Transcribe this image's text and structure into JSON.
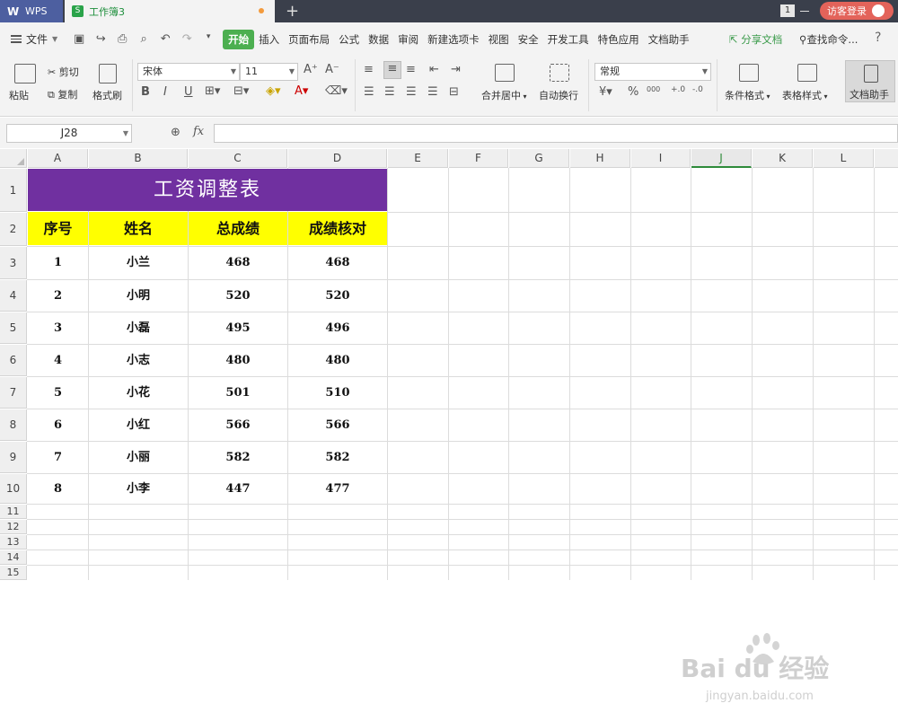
{
  "titlebar": {
    "app_name": "WPS",
    "doc_tab": "工作簿3",
    "doc_icon": "S",
    "window_badge": "1",
    "login": "访客登录",
    "new_tab": "+"
  },
  "menubar": {
    "file": "文件",
    "items": [
      "开始",
      "插入",
      "页面布局",
      "公式",
      "数据",
      "审阅",
      "新建选项卡",
      "视图",
      "安全",
      "开发工具",
      "特色应用",
      "文档助手"
    ],
    "active": "开始",
    "share": "分享文档",
    "find": "查找命令...",
    "help": "?"
  },
  "ribbon": {
    "paste": "粘贴",
    "cut": "剪切",
    "copy": "复制",
    "format_painter": "格式刷",
    "font_name": "宋体",
    "font_size": "11",
    "merge_center": "合并居中",
    "wrap_text": "自动换行",
    "number_format": "常规",
    "conditional_format": "条件格式",
    "table_style": "表格样式",
    "doc_assistant": "文档助手",
    "bold": "B",
    "italic": "I",
    "underline": "U",
    "percent": "%",
    "thousands": "000",
    "dec_inc": "+.0",
    "dec_dec": "-.0"
  },
  "formula_bar": {
    "cell_ref": "J28",
    "fx": "fx",
    "value": ""
  },
  "columns": [
    "A",
    "B",
    "C",
    "D",
    "E",
    "F",
    "G",
    "H",
    "I",
    "J",
    "K",
    "L"
  ],
  "selected_column": "J",
  "rows": [
    "1",
    "2",
    "3",
    "4",
    "5",
    "6",
    "7",
    "8",
    "9",
    "10",
    "11",
    "12",
    "13",
    "14",
    "15"
  ],
  "sheet": {
    "title": "工资调整表",
    "headers": [
      "序号",
      "姓名",
      "总成绩",
      "成绩核对"
    ],
    "data": [
      [
        "1",
        "小兰",
        "468",
        "468"
      ],
      [
        "2",
        "小明",
        "520",
        "520"
      ],
      [
        "3",
        "小磊",
        "495",
        "496"
      ],
      [
        "4",
        "小志",
        "480",
        "480"
      ],
      [
        "5",
        "小花",
        "501",
        "510"
      ],
      [
        "6",
        "小红",
        "566",
        "566"
      ],
      [
        "7",
        "小丽",
        "582",
        "582"
      ],
      [
        "8",
        "小李",
        "447",
        "477"
      ]
    ]
  },
  "watermark": {
    "main": "Bai du 经验",
    "sub": "jingyan.baidu.com"
  },
  "colors": {
    "title_bg": "#7030a0",
    "header_bg": "#ffff00",
    "active_tab": "#4caf50"
  }
}
